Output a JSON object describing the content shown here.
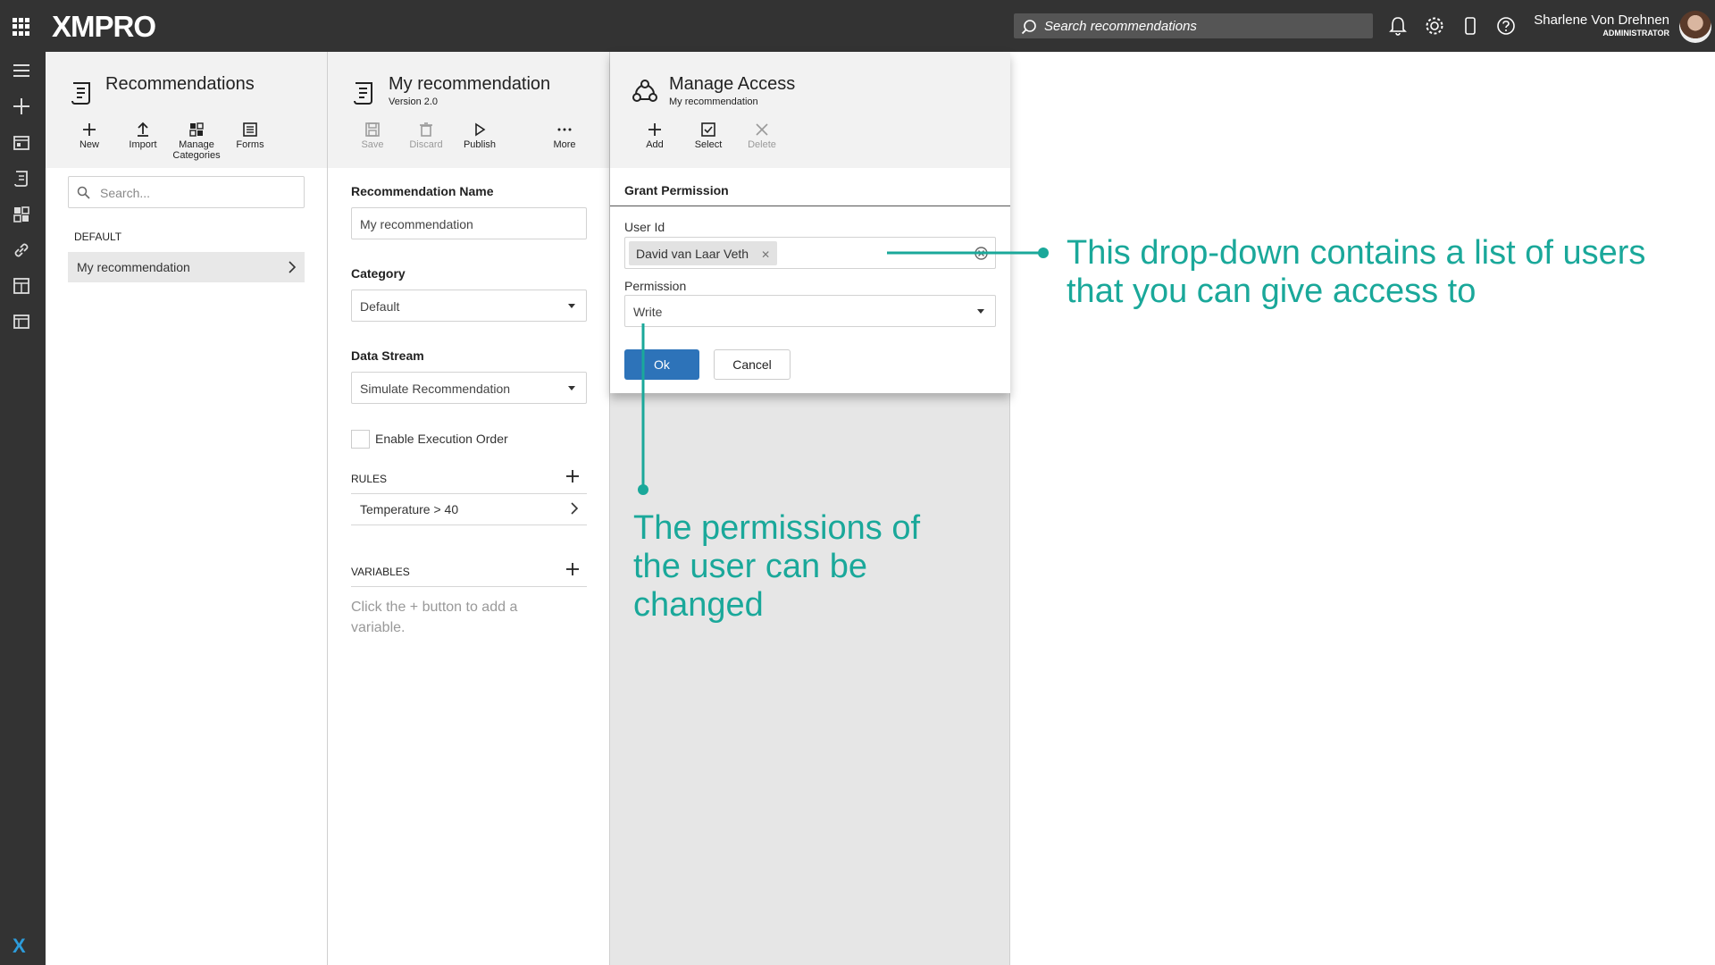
{
  "topbar": {
    "logo": "XMPRO",
    "search_placeholder": "Search recommendations",
    "user_name": "Sharlene Von Drehnen",
    "user_role": "ADMINISTRATOR",
    "icons": [
      "bell-icon",
      "gear-icon",
      "mobile-icon",
      "help-icon"
    ]
  },
  "leftnav": {
    "icons": [
      "menu-icon",
      "plus-icon",
      "layout-icon",
      "scroll-icon",
      "categories-icon",
      "link-icon",
      "dashboard-icon",
      "grid-icon"
    ],
    "brand": "X"
  },
  "recommendations_panel": {
    "title": "Recommendations",
    "toolbar": {
      "new": "New",
      "import": "Import",
      "manage_categories_1": "Manage",
      "manage_categories_2": "Categories",
      "forms": "Forms"
    },
    "search_placeholder": "Search...",
    "group_label": "DEFAULT",
    "items": [
      "My recommendation"
    ]
  },
  "recommendation_panel": {
    "title": "My recommendation",
    "subtitle": "Version 2.0",
    "toolbar": {
      "save": "Save",
      "discard": "Discard",
      "publish": "Publish",
      "more": "More"
    },
    "name_label": "Recommendation Name",
    "name_value": "My recommendation",
    "category_label": "Category",
    "category_value": "Default",
    "datastream_label": "Data Stream",
    "datastream_value": "Simulate Recommendation",
    "execution_order_label": "Enable Execution Order",
    "rules_label": "RULES",
    "rules": [
      "Temperature > 40"
    ],
    "variables_label": "VARIABLES",
    "variables_empty_1": "Click the + button to add a",
    "variables_empty_2": "variable."
  },
  "manage_access_panel": {
    "title": "Manage Access",
    "subtitle": "My recommendation",
    "toolbar": {
      "add": "Add",
      "select": "Select",
      "delete": "Delete"
    }
  },
  "grant_dialog": {
    "title": "Grant Permission",
    "user_id_label": "User Id",
    "user_tag": "David van Laar Veth",
    "permission_label": "Permission",
    "permission_value": "Write",
    "ok": "Ok",
    "cancel": "Cancel"
  },
  "callouts": {
    "dropdown_1": "This drop-down contains a list of users",
    "dropdown_2": "that you can give access to",
    "permission_1": "The permissions of",
    "permission_2": "the user can be",
    "permission_3": "changed",
    "color": "#1aa89a"
  }
}
